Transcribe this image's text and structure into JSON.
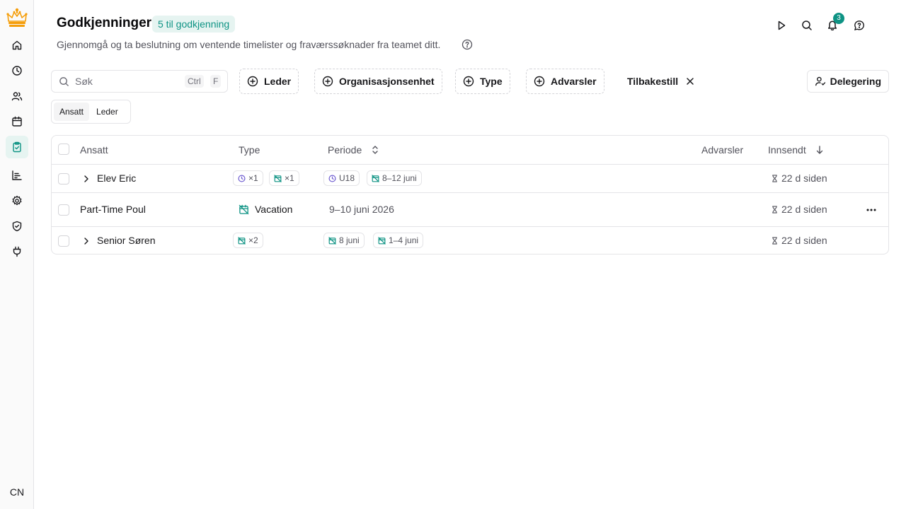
{
  "header": {
    "title": "Godkjenninger",
    "pending_badge": "5 til godkjenning",
    "subtitle": "Gjennomgå og ta beslutning om ventende timelister og fraværssøknader fra teamet ditt.",
    "notification_count": "3"
  },
  "sidebar": {
    "items": [
      {
        "icon": "home-icon"
      },
      {
        "icon": "clock-icon"
      },
      {
        "icon": "users-icon"
      },
      {
        "icon": "calendar-icon"
      },
      {
        "icon": "clipboard-check-icon",
        "active": true
      },
      {
        "icon": "chart-icon"
      },
      {
        "icon": "gear-icon"
      },
      {
        "icon": "shield-icon"
      },
      {
        "icon": "plug-icon"
      }
    ],
    "avatar_initials": "CN"
  },
  "filters": {
    "search_placeholder": "Søk",
    "shortcut_key1": "Ctrl",
    "shortcut_key2": "F",
    "leader": "Leder",
    "org_unit": "Organisasjonsenhet",
    "type": "Type",
    "warnings": "Advarsler",
    "reset": "Tilbakestill",
    "delegation": "Delegering"
  },
  "view_toggle": {
    "employee": "Ansatt",
    "leader": "Leder",
    "selected": "Ansatt"
  },
  "table": {
    "columns": {
      "employee": "Ansatt",
      "type": "Type",
      "period": "Periode",
      "warnings": "Advarsler",
      "submitted": "Innsendt"
    },
    "rows": [
      {
        "name": "Elev Eric",
        "type_chip1": "×1",
        "type_chip2": "×1",
        "period_chip1": "U18",
        "period_chip2": "8–12 juni",
        "submitted": "22 d siden"
      },
      {
        "name": "Part-Time Poul",
        "type_label": "Vacation",
        "period": "9–10 juni 2026",
        "submitted": "22 d siden"
      },
      {
        "name": "Senior Søren",
        "type_chip1": "×2",
        "period_chip1": "8 juni",
        "period_chip2": "1–4 juni",
        "submitted": "22 d siden"
      }
    ]
  },
  "colors": {
    "accent": "#0e9384",
    "accent_bg": "#e6f4f1",
    "clock_purple": "#6d5bd0",
    "logo_orange": "#f59e0b"
  }
}
